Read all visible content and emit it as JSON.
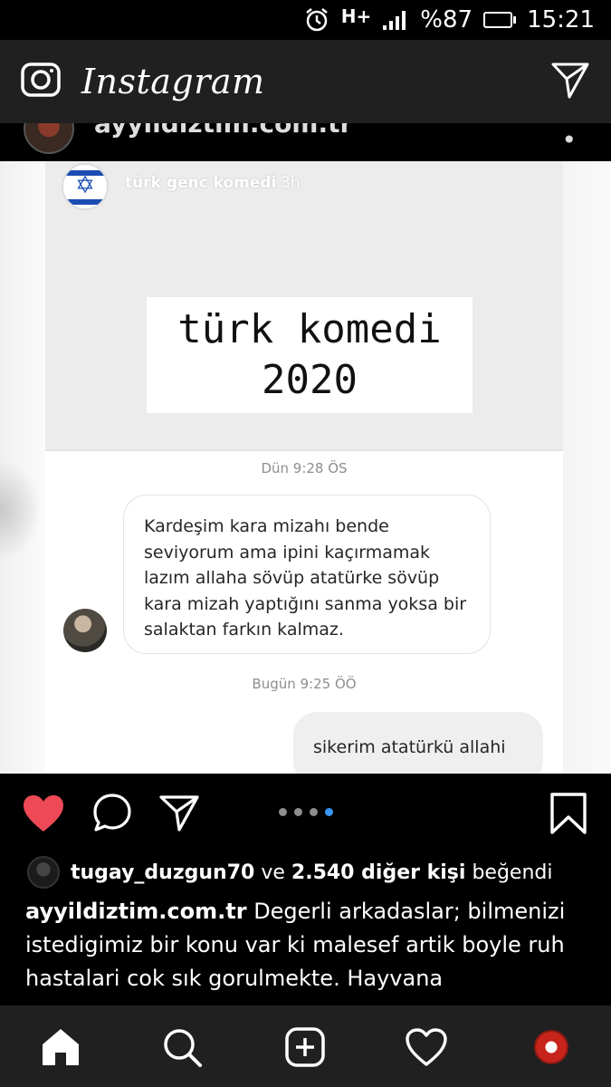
{
  "status_bar": {
    "network": "H+",
    "battery": "%87",
    "battery_level": 0.87,
    "time": "15:21",
    "icons": [
      "alarm-icon",
      "signal-icon",
      "battery-icon"
    ]
  },
  "header": {
    "brand": "Instagram",
    "icons": [
      "camera-icon",
      "direct-message-icon"
    ]
  },
  "post": {
    "author": "ayyildiztim.com.tr",
    "image": {
      "story_user": "türk genc komedi",
      "story_time": "3h",
      "meme_line1": "türk komedi",
      "meme_line2": "2020",
      "chat_time_1": "Dün 9:28 ÖS",
      "chat_message_in": "Kardeşim kara mizahı bende seviyorum ama ipini kaçırmamak lazım allaha sövüp atatürke sövüp kara mizah yaptığını sanma yoksa bir salaktan farkın kalmaz.",
      "chat_time_2": "Bugün 9:25 ÖÖ",
      "chat_message_out": "sikerim atatürkü allahi"
    },
    "carousel": {
      "count": 4,
      "active_index": 3
    },
    "likes": {
      "user": "tugay_duzgun70",
      "connector": "ve",
      "others": "2.540 diğer kişi",
      "suffix": "beğendi"
    },
    "caption": {
      "username": "ayyildiztim.com.tr",
      "text": "Degerli arkadaslar; bilmenizi istedigimiz bir konu var ki malesef artik boyle ruh hastalari cok sık gorulmekte. Hayvana"
    }
  },
  "colors": {
    "like_red": "#ed4956",
    "carousel_active": "#3897f0",
    "header_bg": "#202020"
  },
  "bottom_nav": [
    "home-icon",
    "search-icon",
    "new-post-icon",
    "activity-icon",
    "profile-avatar"
  ]
}
